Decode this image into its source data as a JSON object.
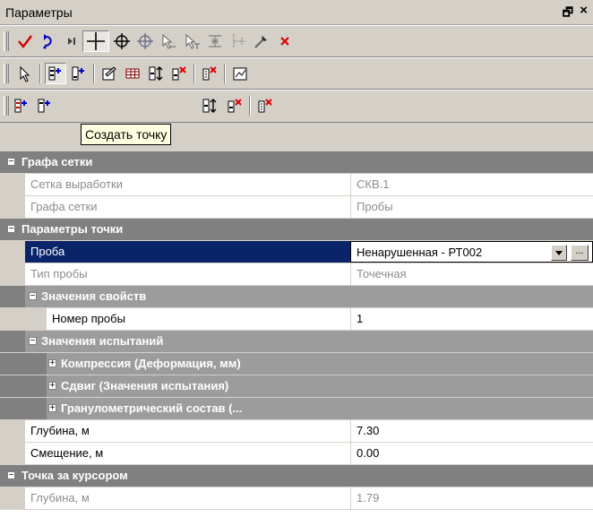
{
  "window": {
    "title": "Параметры"
  },
  "toolbar1": {
    "icons": [
      "grip",
      "check-icon",
      "undo-icon",
      "skip-icon",
      "crosshair-icon",
      "target-icon",
      "target2-icon",
      "select-cursor-icon",
      "select-cursor2-icon",
      "snap-icon",
      "node-icon",
      "pick-icon",
      "delete-icon"
    ]
  },
  "toolbar2": {
    "icons": [
      "pointer-icon",
      "add-point-icon",
      "add-point2-icon",
      "properties-icon",
      "table-icon",
      "move-point-icon",
      "delete-point-icon",
      "delete-all-icon",
      "report-icon"
    ]
  },
  "toolbar3": {
    "tooltip": "Создать точку"
  },
  "grid": {
    "cat1": {
      "label": "Графа сетки"
    },
    "r1": {
      "name": "Сетка выработки",
      "value": "СКВ.1"
    },
    "r2": {
      "name": "Графа сетки",
      "value": "Пробы"
    },
    "cat2": {
      "label": "Параметры точки"
    },
    "r3": {
      "name": "Проба",
      "value": "Ненарушенная - РТ002"
    },
    "r4": {
      "name": "Тип пробы",
      "value": "Точечная"
    },
    "cat3": {
      "label": "Значения свойств"
    },
    "r5": {
      "name": "Номер пробы",
      "value": "1"
    },
    "cat4": {
      "label": "Значения испытаний"
    },
    "cat5": {
      "label": "Компрессия (Деформация, мм)"
    },
    "cat6": {
      "label": "Сдвиг (Значения испытания)"
    },
    "cat7": {
      "label": "Гранулометрический состав (..."
    },
    "r6": {
      "name": "Глубина, м",
      "value": "7.30"
    },
    "r7": {
      "name": "Смещение, м",
      "value": "0.00"
    },
    "cat8": {
      "label": "Точка за курсором"
    },
    "r8": {
      "name": "Глубина, м",
      "value": "1.79"
    }
  }
}
